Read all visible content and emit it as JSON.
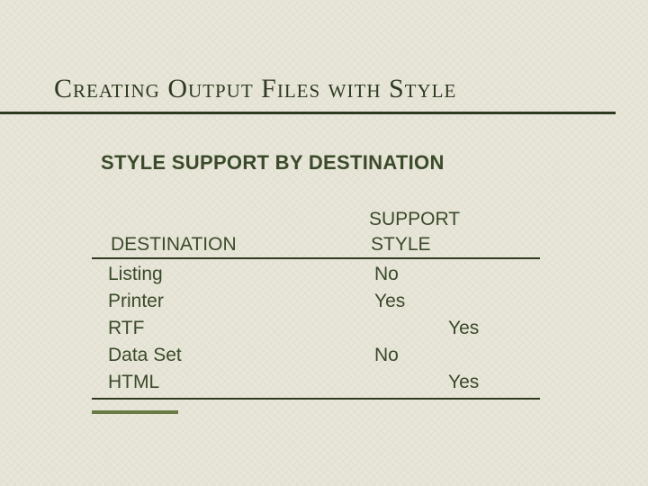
{
  "title": "Creating Output Files with Style",
  "subtitle": "STYLE SUPPORT BY DESTINATION",
  "table": {
    "header_support": "SUPPORT",
    "header_destination": "DESTINATION",
    "header_style": "STYLE",
    "rows": [
      {
        "destination": "Listing",
        "support": "No",
        "align": "a"
      },
      {
        "destination": "Printer",
        "support": "Yes",
        "align": "a"
      },
      {
        "destination": "RTF",
        "support": "Yes",
        "align": "b"
      },
      {
        "destination": "Data Set",
        "support": "No",
        "align": "a"
      },
      {
        "destination": "HTML",
        "support": "Yes",
        "align": "b"
      }
    ]
  }
}
